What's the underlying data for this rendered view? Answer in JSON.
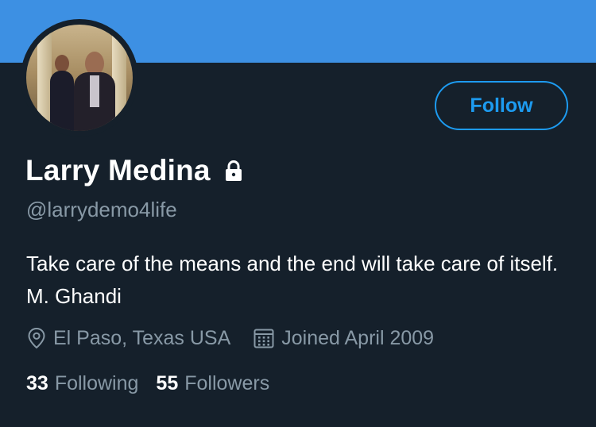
{
  "profile": {
    "name": "Larry Medina",
    "handle": "@larrydemo4life",
    "bio": "Take care of the means and the end will take care of itself. M. Ghandi",
    "location": "El Paso, Texas USA",
    "joined": "Joined April 2009",
    "locked": true
  },
  "actions": {
    "follow_label": "Follow"
  },
  "stats": {
    "following_count": "33",
    "following_label": "Following",
    "followers_count": "55",
    "followers_label": "Followers"
  },
  "icons": {
    "lock": "lock-icon",
    "location": "location-pin-icon",
    "calendar": "calendar-icon"
  },
  "colors": {
    "banner": "#3d90e3",
    "background": "#15202b",
    "accent": "#1d9bf0",
    "secondary_text": "#8899a6"
  }
}
